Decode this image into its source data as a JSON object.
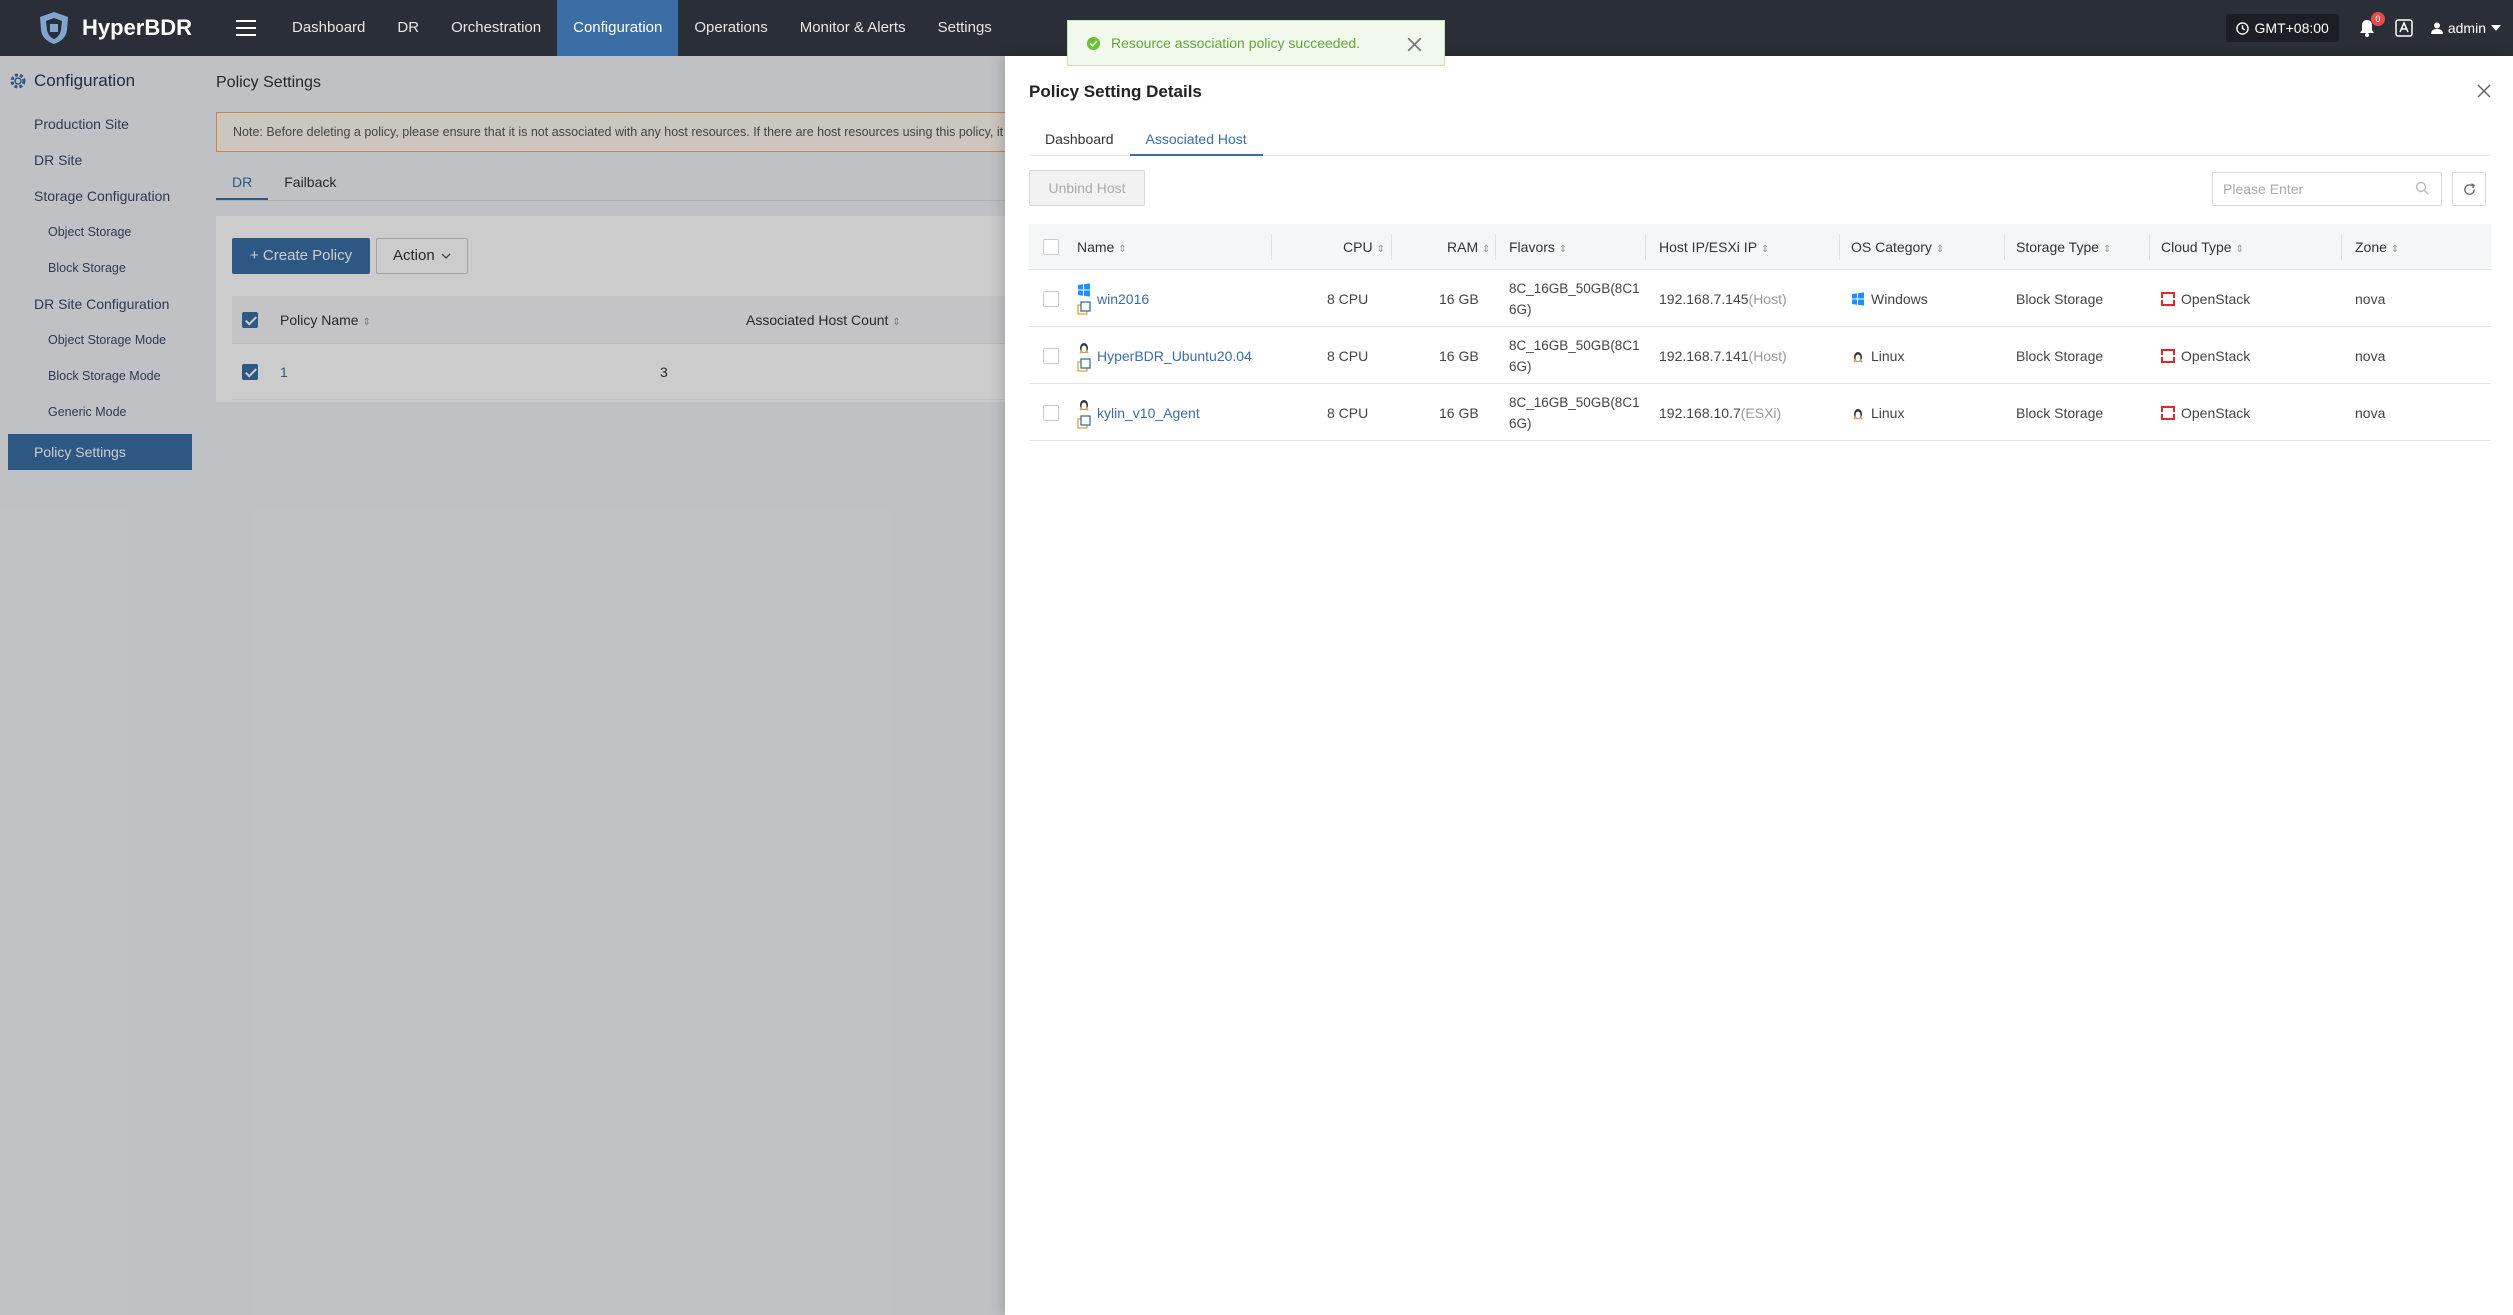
{
  "app": {
    "brand": "HyperBDR"
  },
  "nav": {
    "items": [
      "Dashboard",
      "DR",
      "Orchestration",
      "Configuration",
      "Operations",
      "Monitor & Alerts",
      "Settings"
    ]
  },
  "topbar": {
    "timezone": "GMT+08:00",
    "notifications": "0",
    "user": "admin"
  },
  "sidebar": {
    "title": "Configuration",
    "items": [
      {
        "label": "Production Site"
      },
      {
        "label": "DR Site"
      },
      {
        "label": "Storage Configuration"
      },
      {
        "label": "Object Storage"
      },
      {
        "label": "Block Storage"
      },
      {
        "label": "DR Site Configuration"
      },
      {
        "label": "Object Storage Mode"
      },
      {
        "label": "Block Storage Mode"
      },
      {
        "label": "Generic Mode"
      },
      {
        "label": "Policy Settings"
      }
    ]
  },
  "main": {
    "title": "Policy Settings",
    "note": "Note: Before deleting a policy, please ensure that it is not associated with any host resources. If there are host resources using this policy, it cannot",
    "tabs": [
      "DR",
      "Failback"
    ],
    "create_label": "+ Create Policy",
    "action_label": "Action",
    "columns": [
      "Policy Name",
      "Associated Host Count"
    ],
    "rows": [
      {
        "name": "1",
        "count": "3"
      }
    ]
  },
  "toast": {
    "message": "Resource association policy succeeded."
  },
  "drawer": {
    "title": "Policy Setting Details",
    "tabs": [
      "Dashboard",
      "Associated Host"
    ],
    "unbind_label": "Unbind Host",
    "search_placeholder": "Please Enter",
    "columns": [
      "Name",
      "CPU",
      "RAM",
      "Flavors",
      "Host IP/ESXi IP",
      "OS Category",
      "Storage Type",
      "Cloud Type",
      "Zone"
    ],
    "hosts": [
      {
        "name": "win2016",
        "cpu": "8 CPU",
        "ram": "16 GB",
        "flavor_line1": "8C_16GB_50GB(8C1",
        "flavor_line2": "6G)",
        "ip": "192.168.7.145",
        "ip_type": "(Host)",
        "os": "Windows",
        "storage": "Block Storage",
        "cloud": "OpenStack",
        "zone": "nova"
      },
      {
        "name": "HyperBDR_Ubuntu20.04",
        "cpu": "8 CPU",
        "ram": "16 GB",
        "flavor_line1": "8C_16GB_50GB(8C1",
        "flavor_line2": "6G)",
        "ip": "192.168.7.141",
        "ip_type": "(Host)",
        "os": "Linux",
        "storage": "Block Storage",
        "cloud": "OpenStack",
        "zone": "nova"
      },
      {
        "name": "kylin_v10_Agent",
        "cpu": "8 CPU",
        "ram": "16 GB",
        "flavor_line1": "8C_16GB_50GB(8C1",
        "flavor_line2": "6G)",
        "ip": "192.168.10.7",
        "ip_type": "(ESXi)",
        "os": "Linux",
        "storage": "Block Storage",
        "cloud": "OpenStack",
        "zone": "nova"
      }
    ]
  },
  "colors": {
    "accent": "#3a6ea5",
    "topbar": "#2a2e36",
    "success": "#67a33e",
    "openstack": "#e0282e",
    "windows": "#1e90ff"
  }
}
